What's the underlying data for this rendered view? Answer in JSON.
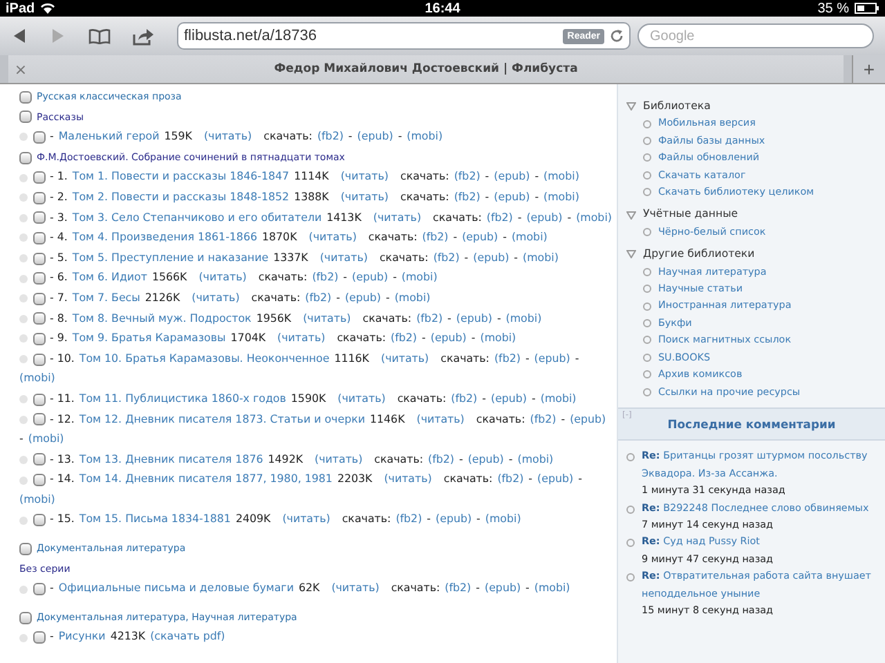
{
  "status_bar": {
    "carrier": "iPad",
    "time": "16:44",
    "battery": "35 %"
  },
  "toolbar": {
    "forward_disabled": true,
    "url": "flibusta.net/a/18736",
    "reader": "Reader",
    "search_placeholder": "Google"
  },
  "tab": {
    "close": "×",
    "title": "Федор Михайлович Достоевский | Флибуста",
    "new_tab": "+"
  },
  "separator": "-",
  "rows": [
    {
      "kind": "genre",
      "checked": false,
      "title": "Русская классическая проза"
    },
    {
      "kind": "series",
      "checked": false,
      "title": "Рассказы"
    },
    {
      "kind": "book",
      "checked": false,
      "number": "-",
      "title": "Маленький герой",
      "size": "159K",
      "read": "(читать)",
      "download": "скачать:",
      "formats": [
        "(fb2)",
        "(epub)",
        "(mobi)"
      ]
    },
    {
      "kind": "series",
      "checked": false,
      "title": "Ф.М.Достоевский. Собрание сочинений в пятнадцати томах"
    },
    {
      "kind": "book",
      "checked": false,
      "number": "- 1.",
      "title": "Том 1. Повести и рассказы 1846-1847",
      "size": "1114K",
      "read": "(читать)",
      "download": "скачать:",
      "formats": [
        "(fb2)",
        "(epub)",
        "(mobi)"
      ]
    },
    {
      "kind": "book",
      "checked": false,
      "number": "- 2.",
      "title": "Том 2. Повести и рассказы 1848-1852",
      "size": "1388K",
      "read": "(читать)",
      "download": "скачать:",
      "formats": [
        "(fb2)",
        "(epub)",
        "(mobi)"
      ]
    },
    {
      "kind": "book",
      "checked": false,
      "number": "- 3.",
      "title": "Том 3. Село Степанчиково и его обитатели",
      "size": "1413K",
      "read": "(читать)",
      "download": "скачать:",
      "formats": [
        "(fb2)",
        "(epub)",
        "(mobi)"
      ]
    },
    {
      "kind": "book",
      "checked": false,
      "number": "- 4.",
      "title": "Том 4. Произведения 1861-1866",
      "size": "1870K",
      "read": "(читать)",
      "download": "скачать:",
      "formats": [
        "(fb2)",
        "(epub)",
        "(mobi)"
      ]
    },
    {
      "kind": "book",
      "checked": false,
      "number": "- 5.",
      "title": "Том 5. Преступление и наказание",
      "size": "1337K",
      "read": "(читать)",
      "download": "скачать:",
      "formats": [
        "(fb2)",
        "(epub)",
        "(mobi)"
      ]
    },
    {
      "kind": "book",
      "checked": false,
      "number": "- 6.",
      "title": "Том 6. Идиот",
      "size": "1566K",
      "read": "(читать)",
      "download": "скачать:",
      "formats": [
        "(fb2)",
        "(epub)",
        "(mobi)"
      ]
    },
    {
      "kind": "book",
      "checked": false,
      "number": "- 7.",
      "title": "Том 7. Бесы",
      "size": "2126K",
      "read": "(читать)",
      "download": "скачать:",
      "formats": [
        "(fb2)",
        "(epub)",
        "(mobi)"
      ]
    },
    {
      "kind": "book",
      "checked": false,
      "number": "- 8.",
      "title": "Том 8. Вечный муж. Подросток",
      "size": "1956K",
      "read": "(читать)",
      "download": "скачать:",
      "formats": [
        "(fb2)",
        "(epub)",
        "(mobi)"
      ]
    },
    {
      "kind": "book",
      "checked": false,
      "number": "- 9.",
      "title": "Том 9. Братья Карамазовы",
      "size": "1704K",
      "read": "(читать)",
      "download": "скачать:",
      "formats": [
        "(fb2)",
        "(epub)",
        "(mobi)"
      ]
    },
    {
      "kind": "book",
      "checked": false,
      "number": "- 10.",
      "title": "Том 10. Братья Карамазовы. Неоконченное",
      "size": "1116K",
      "read": "(читать)",
      "download": "скачать:",
      "formats": [
        "(fb2)",
        "(epub)",
        "(mobi)"
      ]
    },
    {
      "kind": "book",
      "checked": false,
      "number": "- 11.",
      "title": "Том 11. Публицистика 1860-х годов",
      "size": "1590K",
      "read": "(читать)",
      "download": "скачать:",
      "formats": [
        "(fb2)",
        "(epub)",
        "(mobi)"
      ]
    },
    {
      "kind": "book",
      "checked": false,
      "number": "- 12.",
      "title": "Том 12. Дневник писателя 1873. Статьи и очерки",
      "size": "1146K",
      "read": "(читать)",
      "download": "скачать:",
      "formats": [
        "(fb2)",
        "(epub)",
        "(mobi)"
      ]
    },
    {
      "kind": "book",
      "checked": false,
      "number": "- 13.",
      "title": "Том 13. Дневник писателя 1876",
      "size": "1492K",
      "read": "(читать)",
      "download": "скачать:",
      "formats": [
        "(fb2)",
        "(epub)",
        "(mobi)"
      ]
    },
    {
      "kind": "book",
      "checked": false,
      "number": "- 14.",
      "title": "Том 14. Дневник писателя 1877, 1980, 1981",
      "size": "2203K",
      "read": "(читать)",
      "download": "скачать:",
      "formats": [
        "(fb2)",
        "(epub)",
        "(mobi)"
      ]
    },
    {
      "kind": "book",
      "checked": false,
      "number": "- 15.",
      "title": "Том 15. Письма 1834-1881",
      "size": "2409K",
      "read": "(читать)",
      "download": "скачать:",
      "formats": [
        "(fb2)",
        "(epub)",
        "(mobi)"
      ]
    },
    {
      "kind": "genre",
      "checked": false,
      "title": "Документальная литература"
    },
    {
      "kind": "label",
      "title": "Без серии"
    },
    {
      "kind": "book",
      "checked": false,
      "number": "-",
      "title": "Официальные письма и деловые бумаги",
      "size": "62K",
      "read": "(читать)",
      "download": "скачать:",
      "formats": [
        "(fb2)",
        "(epub)",
        "(mobi)"
      ]
    },
    {
      "kind": "genre",
      "checked": false,
      "title": "Документальная литература, Научная литература"
    },
    {
      "kind": "pdf",
      "checked": false,
      "number": "-",
      "title": "Рисунки",
      "size": "4213K",
      "download": "(скачать pdf)"
    }
  ],
  "sidebar": {
    "sections": [
      {
        "title": "Библиотека",
        "items": [
          "Мобильная версия",
          "Файлы базы данных",
          "Файлы обновлений",
          "Скачать каталог",
          "Скачать библиотеку целиком"
        ]
      },
      {
        "title": "Учётные данные",
        "items": [
          "Чёрно-белый список"
        ]
      },
      {
        "title": "Другие библиотеки",
        "items": [
          "Научная литература",
          "Научные статьи",
          "Иностранная литература",
          "Букфи",
          "Поиск магнитных ссылок",
          "SU.BOOKS",
          "Архив комиксов",
          "Ссылки на прочие ресурсы"
        ]
      }
    ],
    "comments": {
      "toggle": "[-]",
      "title": "Последние комментарии",
      "items": [
        {
          "re": "Re:",
          "title": "Британцы грозят штурмом посольству Эквадора. Из-за Ассанжа.",
          "time": "1 минута 31 секунда назад"
        },
        {
          "re": "Re:",
          "title": "B292248 Последнее слово обвиняемых",
          "time": "7 минут 14 секунд назад"
        },
        {
          "re": "Re:",
          "title": "Суд над Pussy Riot",
          "time": "9 минут 47 секунд назад"
        },
        {
          "re": "Re:",
          "title": "Отвратительная работа сайта внушает неподдельное уныние",
          "time": "15 минут 8 секунд назад"
        }
      ]
    }
  }
}
